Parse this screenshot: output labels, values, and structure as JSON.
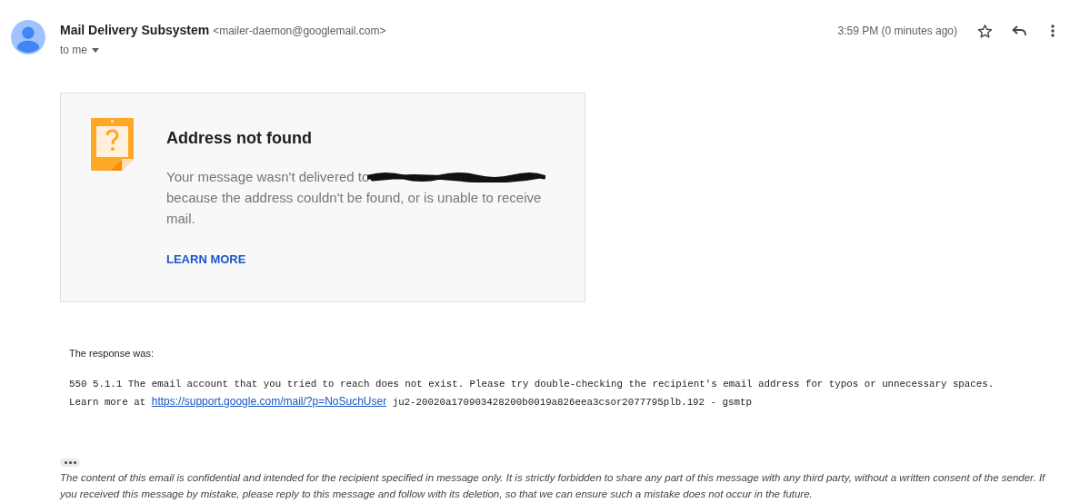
{
  "header": {
    "sender_name": "Mail Delivery Subsystem",
    "sender_email": "<mailer-daemon@googlemail.com>",
    "recipient": "to me",
    "time": "3:59 PM (0 minutes ago)",
    "starred": false
  },
  "card": {
    "title": "Address not found",
    "message_start": "Your message wasn't delivered to",
    "message_rest": "because the address couldn't be found, or is unable to receive mail.",
    "link": "LEARN MORE"
  },
  "response": {
    "label": "The response was:",
    "line_1": "550 5.1.1 The email account that you tried to reach does not exist. Please try double-checking the recipient's email address for typos or unnecessary spaces.",
    "line_2_start": "Learn more at",
    "link": "https://support.google.com/mail/?p=NoSuchUser",
    "line_2_end": "ju2-20020a170903428200b0019a826eea3csor2077795plb.192 - gsmtp"
  },
  "footer": {
    "disclaimer": "The content of this email is confidential and intended for the recipient specified in message only. It is strictly forbidden to share any part of this message with any third party, without a written consent of the sender. If you received this message by mistake, please reply to this message and follow with its deletion, so that we can ensure such a mistake does not occur in the future."
  }
}
